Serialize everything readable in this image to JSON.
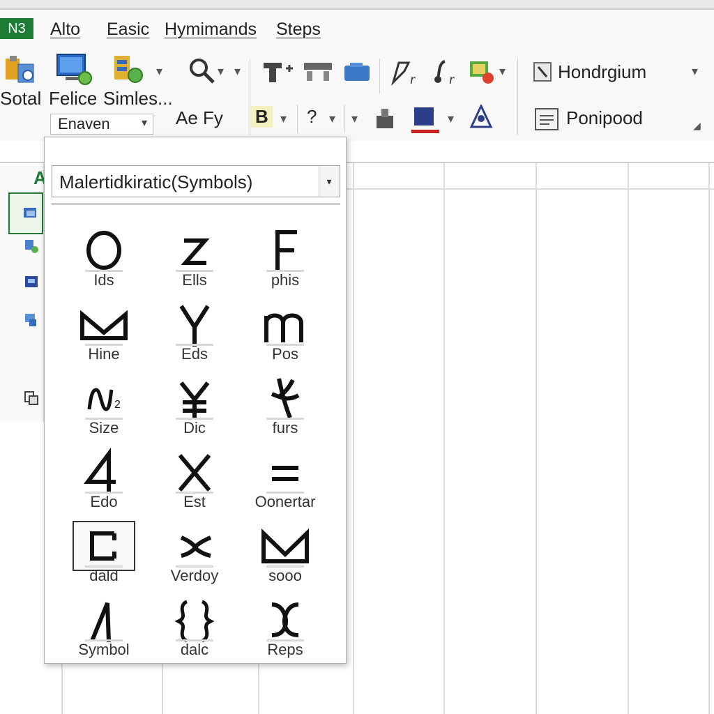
{
  "app": {
    "badge": "N3"
  },
  "tabs": [
    "Alto",
    "Easic",
    "Hymimands",
    "Steps"
  ],
  "ribbon": {
    "big_labels": [
      "Sotal",
      "Felice",
      "Simles..."
    ],
    "style_combo": "Enaven",
    "font_pair": "Ae Fy",
    "bold_label": "B",
    "question_label": "?",
    "right_items": [
      "Hondrgium",
      "Ponipood"
    ],
    "icons": [
      "clipboard-icon",
      "computer-icon",
      "database-icon",
      "search-icon",
      "text-format-icon",
      "table-icon",
      "folder-icon",
      "draw-icon",
      "function-icon",
      "fill-color-icon",
      "style-icon",
      "document-icon",
      "lock-icon",
      "font-color-icon",
      "tree-icon"
    ]
  },
  "sheet": {
    "column_letter": "A"
  },
  "symbol_popup": {
    "font_select": "Malertidkiratic(Symbols)",
    "symbols": [
      {
        "label": "Ids",
        "icon": "circle-o-icon"
      },
      {
        "label": "Ells",
        "icon": "letter-z-icon"
      },
      {
        "label": "phis",
        "icon": "letter-f-icon"
      },
      {
        "label": "Hine",
        "icon": "m-shape-icon"
      },
      {
        "label": "Eds",
        "icon": "letter-y-icon"
      },
      {
        "label": "Pos",
        "icon": "letter-m-icon"
      },
      {
        "label": "Size",
        "icon": "wave-n2-icon"
      },
      {
        "label": "Dic",
        "icon": "yen-icon"
      },
      {
        "label": "furs",
        "icon": "branch-k-icon"
      },
      {
        "label": "Edo",
        "icon": "digit-4-icon"
      },
      {
        "label": "Est",
        "icon": "cross-x-icon"
      },
      {
        "label": "Oonertar",
        "icon": "equals-icon"
      },
      {
        "label": "dald",
        "icon": "square-c-icon"
      },
      {
        "label": "Verdoy",
        "icon": "x-curve-icon"
      },
      {
        "label": "sooo",
        "icon": "m-triangle-icon"
      },
      {
        "label": "Symbol",
        "icon": "lambda-icon"
      },
      {
        "label": "dalc",
        "icon": "brace-icon"
      },
      {
        "label": "Reps",
        "icon": "omega-icon"
      }
    ]
  },
  "colors": {
    "accent_green": "#1e7b34",
    "ribbon_bg": "#f8f8f8",
    "grid_line": "#dcdcdc"
  }
}
